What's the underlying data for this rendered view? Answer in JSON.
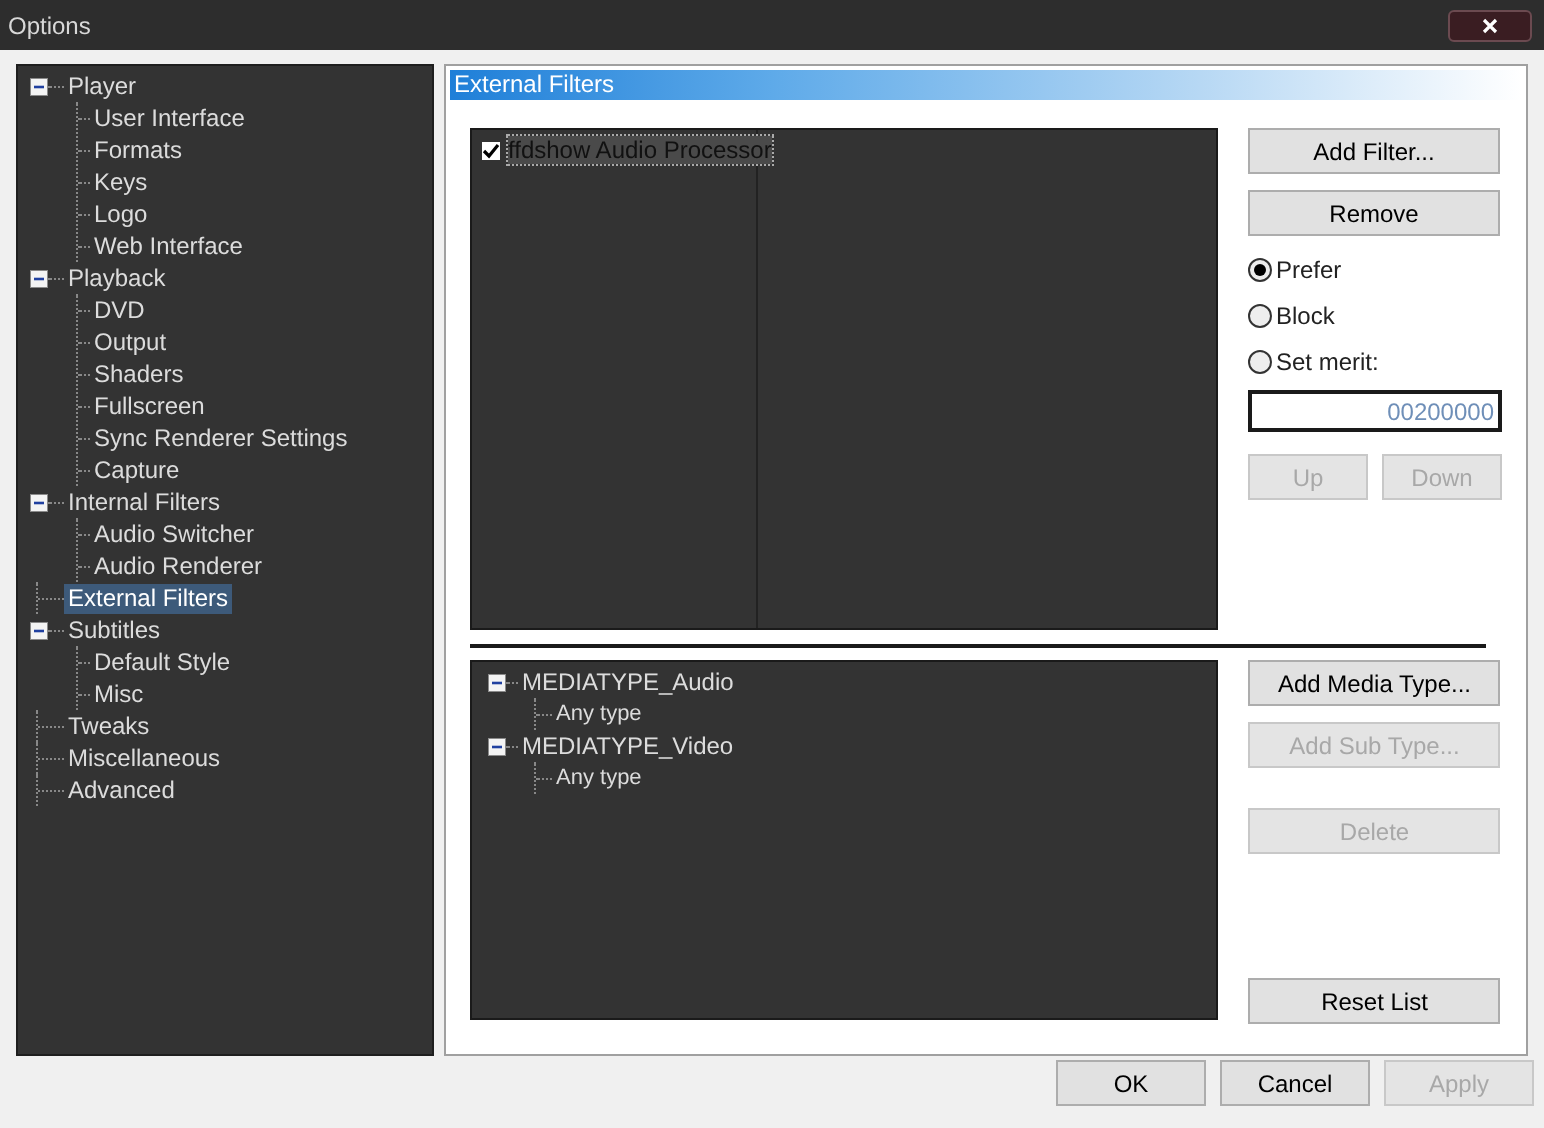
{
  "window": {
    "title": "Options"
  },
  "sidebar": {
    "items": [
      {
        "label": "Player",
        "selected": false,
        "expanded": true,
        "children": [
          {
            "label": "User Interface",
            "selected": false
          },
          {
            "label": "Formats",
            "selected": false
          },
          {
            "label": "Keys",
            "selected": false
          },
          {
            "label": "Logo",
            "selected": false
          },
          {
            "label": "Web Interface",
            "selected": false
          }
        ]
      },
      {
        "label": "Playback",
        "selected": false,
        "expanded": true,
        "children": [
          {
            "label": "DVD",
            "selected": false
          },
          {
            "label": "Output",
            "selected": false
          },
          {
            "label": "Shaders",
            "selected": false
          },
          {
            "label": "Fullscreen",
            "selected": false
          },
          {
            "label": "Sync Renderer Settings",
            "selected": false
          },
          {
            "label": "Capture",
            "selected": false
          }
        ]
      },
      {
        "label": "Internal Filters",
        "selected": false,
        "expanded": true,
        "children": [
          {
            "label": "Audio Switcher",
            "selected": false
          },
          {
            "label": "Audio Renderer",
            "selected": false
          }
        ]
      },
      {
        "label": "External Filters",
        "selected": true
      },
      {
        "label": "Subtitles",
        "selected": false,
        "expanded": true,
        "children": [
          {
            "label": "Default Style",
            "selected": false
          },
          {
            "label": "Misc",
            "selected": false
          }
        ]
      },
      {
        "label": "Tweaks",
        "selected": false
      },
      {
        "label": "Miscellaneous",
        "selected": false
      },
      {
        "label": "Advanced",
        "selected": false
      }
    ]
  },
  "page": {
    "title": "External Filters",
    "filters": [
      {
        "label": "ffdshow Audio Processor",
        "checked": true,
        "selected": true
      }
    ],
    "filter_buttons": [
      {
        "label": "Add Filter...",
        "disabled": false
      },
      {
        "label": "Remove",
        "disabled": false
      }
    ],
    "options": [
      {
        "label": "Prefer",
        "selected": true
      },
      {
        "label": "Block",
        "selected": false
      },
      {
        "label": "Set merit:",
        "selected": false
      }
    ],
    "merit": {
      "value": "00200000"
    },
    "order_buttons": [
      {
        "label": "Up",
        "disabled": true
      },
      {
        "label": "Down",
        "disabled": true
      }
    ],
    "media_types": [
      {
        "label": "MEDIATYPE_Audio",
        "expanded": true,
        "children": [
          {
            "label": "Any type"
          }
        ]
      },
      {
        "label": "MEDIATYPE_Video",
        "expanded": true,
        "children": [
          {
            "label": "Any type"
          }
        ]
      }
    ],
    "media_buttons": [
      {
        "label": "Add Media Type...",
        "disabled": false
      },
      {
        "label": "Add Sub Type...",
        "disabled": true
      },
      {
        "label": "Delete",
        "disabled": true
      },
      {
        "label": "Reset List",
        "disabled": false
      }
    ]
  },
  "footer_buttons": [
    {
      "label": "OK",
      "disabled": false
    },
    {
      "label": "Cancel",
      "disabled": false
    },
    {
      "label": "Apply",
      "disabled": true
    }
  ]
}
